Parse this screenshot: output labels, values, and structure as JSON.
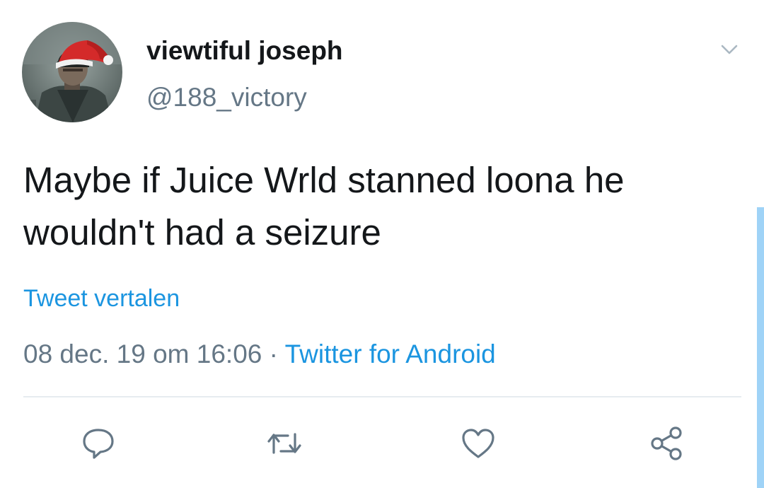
{
  "tweet": {
    "author": {
      "display_name": "viewtiful joseph",
      "handle": "@188_victory",
      "avatar_icon": "avatar-santa-hat"
    },
    "text": "Maybe if Juice Wrld stanned loona he wouldn't had a seizure",
    "translate_label": "Tweet vertalen",
    "timestamp": "08 dec. 19 om 16:06",
    "separator": " · ",
    "source": "Twitter for Android"
  },
  "actions": [
    {
      "name": "reply",
      "icon": "reply-icon"
    },
    {
      "name": "retweet",
      "icon": "retweet-icon"
    },
    {
      "name": "like",
      "icon": "heart-icon"
    },
    {
      "name": "share",
      "icon": "share-icon"
    }
  ],
  "colors": {
    "link": "#1b95e0",
    "secondary_text": "#657786",
    "icon": "#657786",
    "divider": "#e6ecf0",
    "scroll_indicator": "#9fd3f7"
  }
}
